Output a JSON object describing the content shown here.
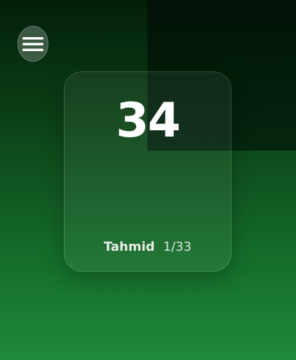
{
  "menu": {
    "icon": "hamburger-menu-icon"
  },
  "counter": {
    "count": "34",
    "name": "Tahmid",
    "progress": "1/33"
  },
  "colors": {
    "background_top": "#031f0a",
    "background_bottom": "#1f8a3a",
    "text": "#ffffff"
  }
}
